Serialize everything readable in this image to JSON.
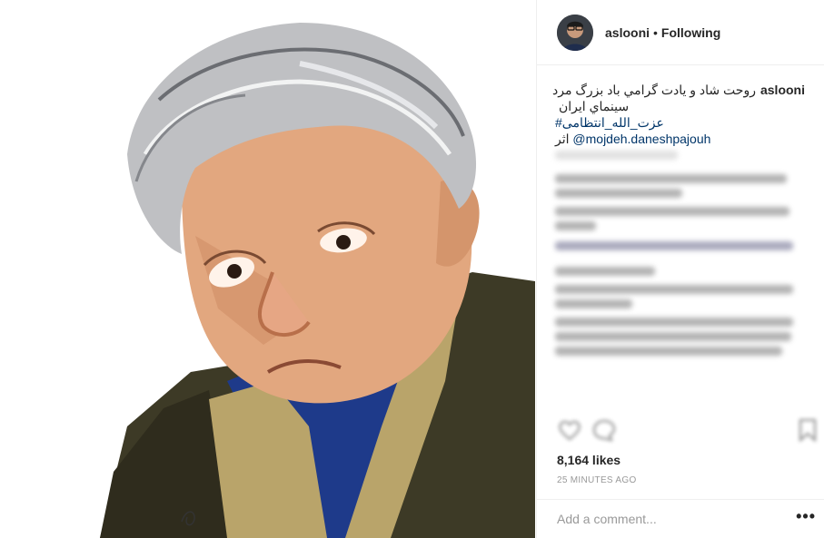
{
  "post": {
    "username": "aslooni",
    "separator": "•",
    "follow_status": "Following",
    "caption": {
      "line1": "روحت شاد و يادت گرامي باد بزرگ مرد",
      "line2": "سينماي ايران",
      "hashtag": "#عزت_الله_انتظامی",
      "credit_prefix": "اثر",
      "mention": "@mojdeh.daneshpajouh"
    },
    "likes": "8,164 likes",
    "timestamp": "25 MINUTES AGO",
    "add_comment_placeholder": "Add a comment...",
    "more_options": "•••"
  },
  "icons": [
    "heart-icon",
    "comment-icon",
    "bookmark-icon",
    "more-options-icon"
  ],
  "colors": {
    "link": "#003569",
    "text": "#262626",
    "muted": "#999999",
    "border": "#efefef"
  }
}
